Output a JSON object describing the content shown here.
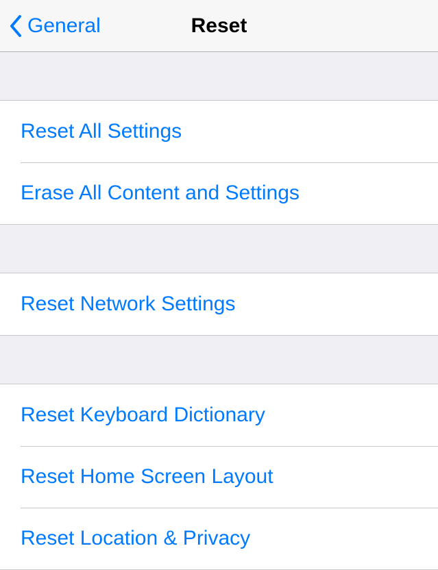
{
  "nav": {
    "back_label": "General",
    "title": "Reset"
  },
  "sections": [
    {
      "rows": [
        {
          "label": "Reset All Settings"
        },
        {
          "label": "Erase All Content and Settings"
        }
      ]
    },
    {
      "rows": [
        {
          "label": "Reset Network Settings"
        }
      ]
    },
    {
      "rows": [
        {
          "label": "Reset Keyboard Dictionary"
        },
        {
          "label": "Reset Home Screen Layout"
        },
        {
          "label": "Reset Location & Privacy"
        }
      ]
    }
  ]
}
